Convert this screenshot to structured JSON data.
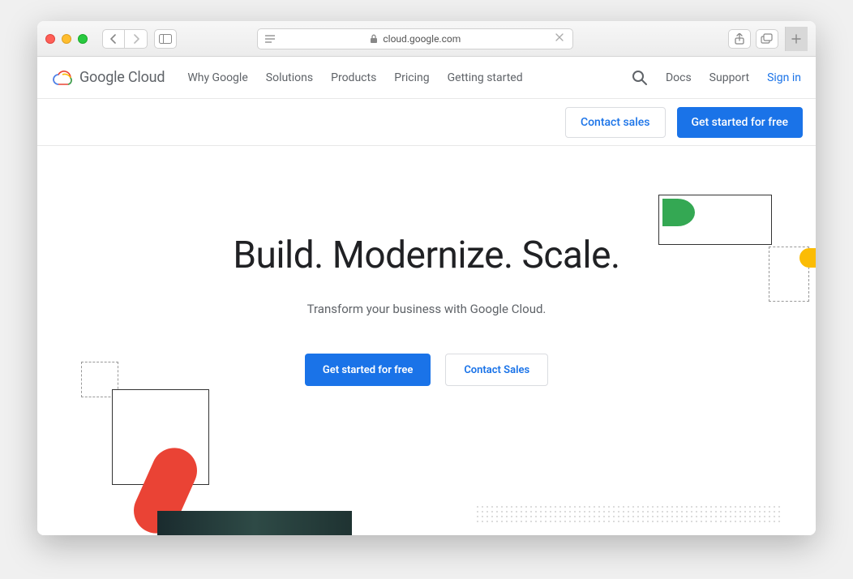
{
  "browser": {
    "url": "cloud.google.com"
  },
  "logo": {
    "text": "Google Cloud"
  },
  "nav": {
    "items": [
      "Why Google",
      "Solutions",
      "Products",
      "Pricing",
      "Getting started"
    ],
    "docs": "Docs",
    "support": "Support",
    "signin": "Sign in"
  },
  "subbar": {
    "contact": "Contact sales",
    "get_started": "Get started for free"
  },
  "hero": {
    "headline": "Build. Modernize. Scale.",
    "subhead": "Transform your business with Google Cloud.",
    "cta_primary": "Get started for free",
    "cta_secondary": "Contact Sales"
  }
}
